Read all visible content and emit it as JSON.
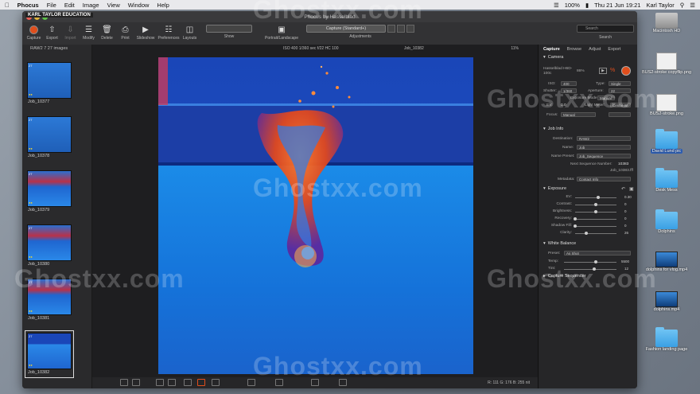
{
  "menubar": {
    "app": "Phocus",
    "items": [
      "File",
      "Edit",
      "Image",
      "View",
      "Window",
      "Help"
    ],
    "battery": "100%",
    "clock": "Thu 21 Jun 19:21",
    "user": "Karl Taylor"
  },
  "window": {
    "title": "Phocus by Hasselblad",
    "overlay_logo": "KARL TAYLOR EDUCATION"
  },
  "toolbar": {
    "buttons": [
      "Capture",
      "Export",
      "Import",
      "Modify",
      "Delete",
      "Print",
      "Slideshow",
      "Preferences",
      "Layouts"
    ],
    "show_label": "Show",
    "portrait_label": "Portrait/Landscape",
    "adjust_value": "Capture (Standard+)",
    "adjust_label": "Adjustments",
    "search_placeholder": "Search",
    "search_label": "Search"
  },
  "filmstrip": {
    "header": "RAW2 7 27 images",
    "items": [
      {
        "label": "Job_10377",
        "badge": "27"
      },
      {
        "label": "Job_10378",
        "badge": "27"
      },
      {
        "label": "Job_10379",
        "badge": "27"
      },
      {
        "label": "Job_10380",
        "badge": "27"
      },
      {
        "label": "Job_10381",
        "badge": "27"
      },
      {
        "label": "Job_10382",
        "badge": "27"
      }
    ]
  },
  "viewer": {
    "exif": "ISO 400   1/360 sec  f/22  HC 100",
    "job": "Job_10382",
    "zoom": "11%",
    "rgb": "R: 111  G: 176  B: 255  nit"
  },
  "panel": {
    "tabs": [
      "Capture",
      "Browse",
      "Adjust",
      "Export"
    ],
    "camera": {
      "title": "Camera",
      "model": "Hasselblad H6D-100c",
      "battery": "86%",
      "iso_label": "ISO:",
      "iso": "400",
      "type_label": "Type:",
      "type": "Single",
      "shutter_label": "Shutter:",
      "shutter": "1/360",
      "aperture_label": "Aperture:",
      "aperture": "22",
      "exposure_mode_label": "Exposure Mode:",
      "exposure_mode": "Manual",
      "ev_label": "EV:",
      "ev": "0.0",
      "light_meter_label": "Light Meter:",
      "light_meter": "Centre W",
      "focus_label": "Focus:",
      "focus": "Manual"
    },
    "jobinfo": {
      "title": "Job Info",
      "destination_label": "Destination:",
      "destination": "RAW2",
      "name_label": "Name:",
      "name": "Job",
      "preset_label": "Name Preset:",
      "preset": "Job_Sequence",
      "next_label": "Next Sequence Number:",
      "next": "10383",
      "next_file": "Job_10383.fff",
      "metadata_label": "Metadata:",
      "metadata": "Contact Info"
    },
    "exposure": {
      "title": "Exposure",
      "sliders": [
        {
          "label": "EV:",
          "value": "0.30",
          "pos": 0.55
        },
        {
          "label": "Contrast:",
          "value": "0",
          "pos": 0.5
        },
        {
          "label": "Brightness:",
          "value": "0",
          "pos": 0.5
        },
        {
          "label": "Recovery:",
          "value": "0",
          "pos": 0.0
        },
        {
          "label": "Shadow Fill:",
          "value": "0",
          "pos": 0.0
        },
        {
          "label": "Clarity:",
          "value": "26",
          "pos": 0.26
        }
      ]
    },
    "whitebalance": {
      "title": "White Balance",
      "preset_label": "Preset:",
      "preset": "As Shot",
      "temp_label": "Temp:",
      "temp": "5500",
      "tint_label": "Tint:",
      "tint": "12"
    },
    "capture_sequencer": "Capture Sequencer"
  },
  "desktop": [
    {
      "label": "Macintosh HD",
      "kind": "hd-icon"
    },
    {
      "label": "BUS2-stroke copyflip.png",
      "kind": "file-icon"
    },
    {
      "label": "BUS2-stroke.png",
      "kind": "file-icon"
    },
    {
      "label": "David Lund pic",
      "kind": "folder-icon",
      "selected": true
    },
    {
      "label": "Desk Mess",
      "kind": "folder-icon"
    },
    {
      "label": "Dolphins",
      "kind": "folder-icon"
    },
    {
      "label": "dolphins for vlog.mp4",
      "kind": "video-icon"
    },
    {
      "label": "dolphins.mp4",
      "kind": "video-icon"
    },
    {
      "label": "Fashion landing page",
      "kind": "folder-icon"
    }
  ],
  "watermark": "Ghostxx.com",
  "colors": {
    "accent": "#e04e1c",
    "water": "#1f6fd8",
    "selection": "#2f61b8"
  }
}
